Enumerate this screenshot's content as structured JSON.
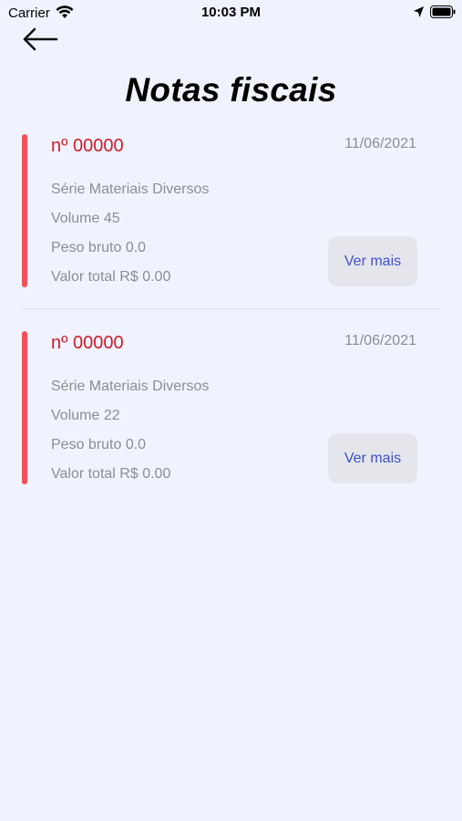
{
  "status_bar": {
    "carrier": "Carrier",
    "time": "10:03 PM"
  },
  "header": {
    "back_icon": "arrow-left-icon",
    "title": "Notas fiscais"
  },
  "colors": {
    "accent_red": "#f0525c",
    "number_red": "#d01b2a",
    "button_text_blue": "#3f50c8",
    "background": "#f0f3fd"
  },
  "invoices": [
    {
      "number": "nº 00000",
      "date": "11/06/2021",
      "series": "Série Materiais Diversos",
      "volume": "Volume 45",
      "gross_weight": "Peso bruto 0.0",
      "total_value": "Valor total R$ 0.00",
      "button_label": "Ver mais"
    },
    {
      "number": "nº 00000",
      "date": "11/06/2021",
      "series": "Série Materiais Diversos",
      "volume": "Volume 22",
      "gross_weight": "Peso bruto 0.0",
      "total_value": "Valor total R$ 0.00",
      "button_label": "Ver mais"
    }
  ]
}
